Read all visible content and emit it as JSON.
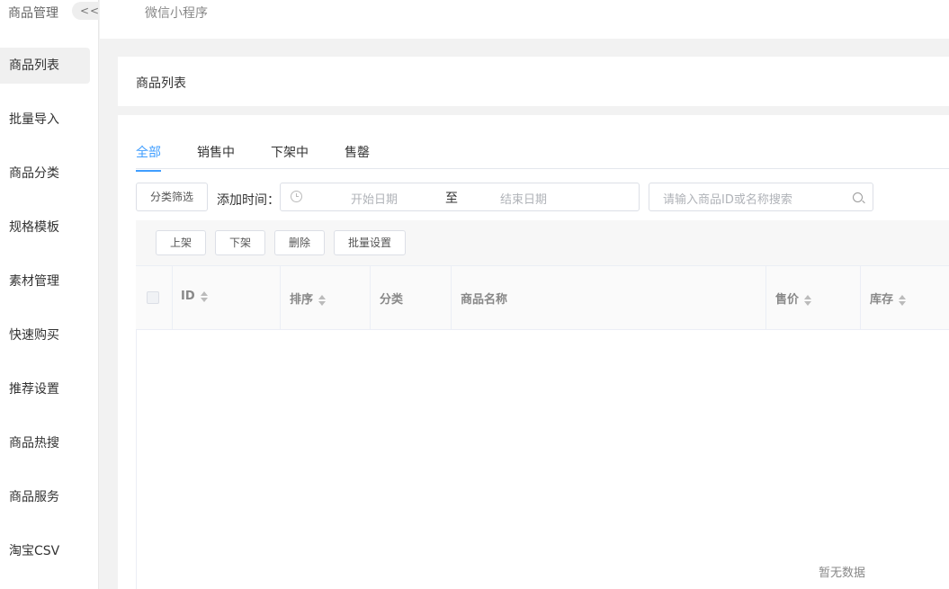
{
  "sidebar": {
    "title": "商品管理",
    "collapse": "<<",
    "items": [
      {
        "label": "商品列表"
      },
      {
        "label": "批量导入"
      },
      {
        "label": "商品分类"
      },
      {
        "label": "规格模板"
      },
      {
        "label": "素材管理"
      },
      {
        "label": "快速购买"
      },
      {
        "label": "推荐设置"
      },
      {
        "label": "商品热搜"
      },
      {
        "label": "商品服务"
      },
      {
        "label": "淘宝CSV"
      }
    ]
  },
  "topbar": {
    "label": "微信小程序"
  },
  "page_title": "商品列表",
  "tabs": [
    {
      "label": "全部"
    },
    {
      "label": "销售中"
    },
    {
      "label": "下架中"
    },
    {
      "label": "售罄"
    }
  ],
  "filters": {
    "category_button": "分类筛选",
    "date_label": "添加时间：",
    "start_placeholder": "开始日期",
    "separator": "至",
    "end_placeholder": "结束日期",
    "search_placeholder": "请输入商品ID或名称搜索"
  },
  "actions": {
    "on_shelf": "上架",
    "off_shelf": "下架",
    "delete": "删除",
    "batch_settings": "批量设置"
  },
  "table": {
    "columns": [
      {
        "label": "ID"
      },
      {
        "label": "排序"
      },
      {
        "label": "分类"
      },
      {
        "label": "商品名称"
      },
      {
        "label": "售价"
      },
      {
        "label": "库存"
      }
    ],
    "empty_text": "暂无数据"
  },
  "colors": {
    "accent": "#409eff"
  }
}
